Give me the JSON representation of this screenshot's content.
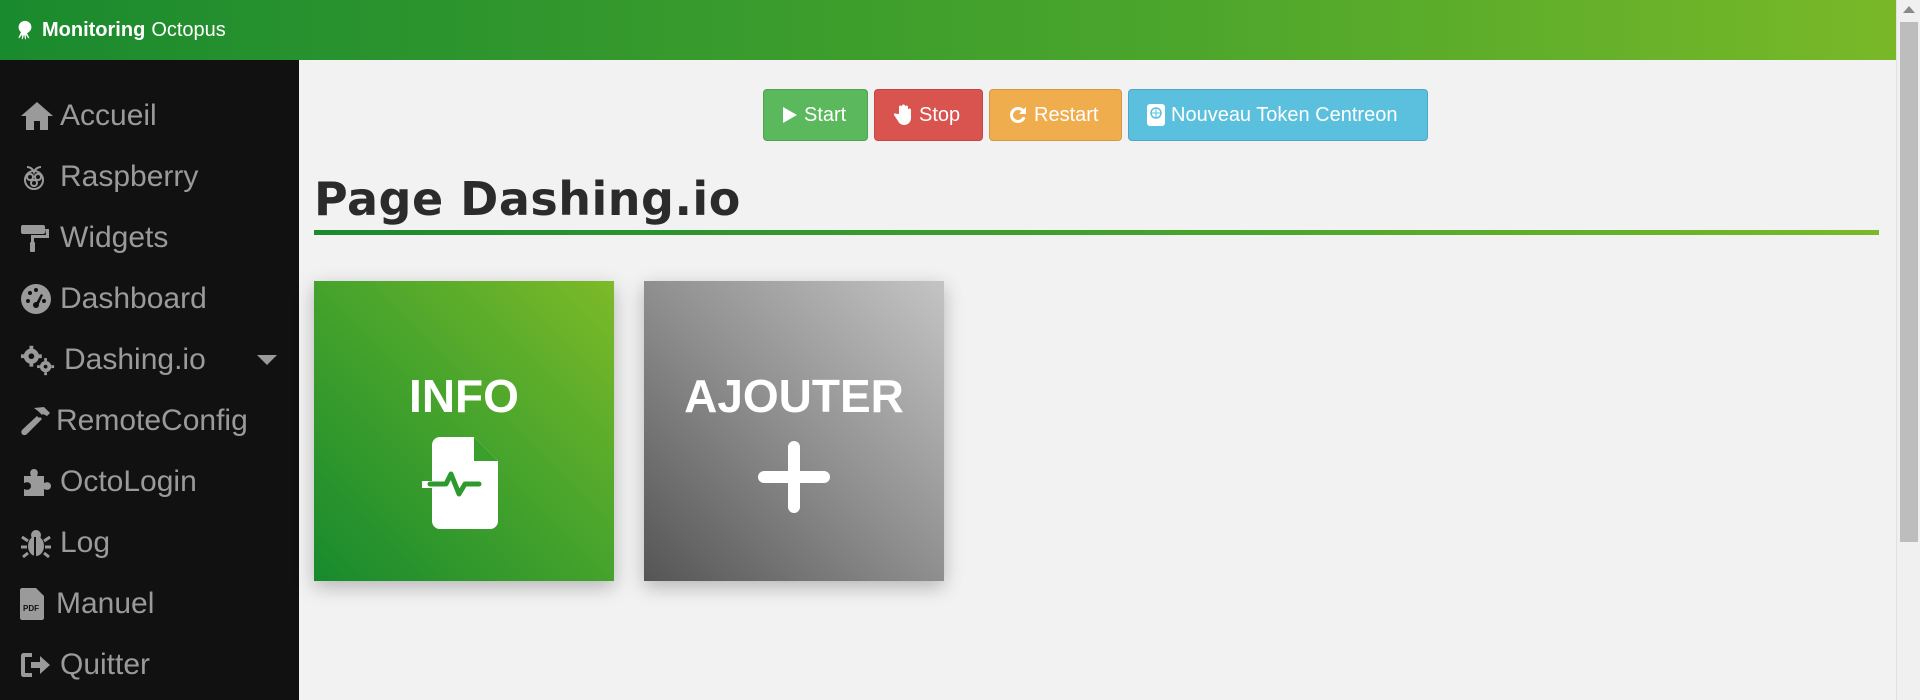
{
  "app": {
    "brand_bold": "Monitoring",
    "brand_rest": "Octopus"
  },
  "sidebar": {
    "items": [
      {
        "label": "Accueil",
        "icon": "home-icon"
      },
      {
        "label": "Raspberry",
        "icon": "raspberry-icon"
      },
      {
        "label": "Widgets",
        "icon": "paint-roller-icon"
      },
      {
        "label": "Dashboard",
        "icon": "tachometer-icon"
      },
      {
        "label": "Dashing.io",
        "icon": "cogs-icon",
        "has_submenu": true
      },
      {
        "label": "RemoteConfig",
        "icon": "hammer-icon"
      },
      {
        "label": "OctoLogin",
        "icon": "puzzle-icon"
      },
      {
        "label": "Log",
        "icon": "bug-icon"
      },
      {
        "label": "Manuel",
        "icon": "pdf-file-icon"
      },
      {
        "label": "Quitter",
        "icon": "sign-out-icon"
      }
    ]
  },
  "toolbar": {
    "start_label": "Start",
    "stop_label": "Stop",
    "restart_label": "Restart",
    "token_label": "Nouveau Token Centreon"
  },
  "page": {
    "title": "Page Dashing.io"
  },
  "tiles": {
    "info_label": "INFO",
    "add_label": "AJOUTER"
  },
  "colors": {
    "brand_green_dark": "#1a8a2e",
    "brand_green_light": "#7ab928",
    "sidebar_bg": "#111111",
    "start": "#5cb85c",
    "stop": "#d9534f",
    "restart": "#f0ad4e",
    "token": "#5bc0de"
  }
}
